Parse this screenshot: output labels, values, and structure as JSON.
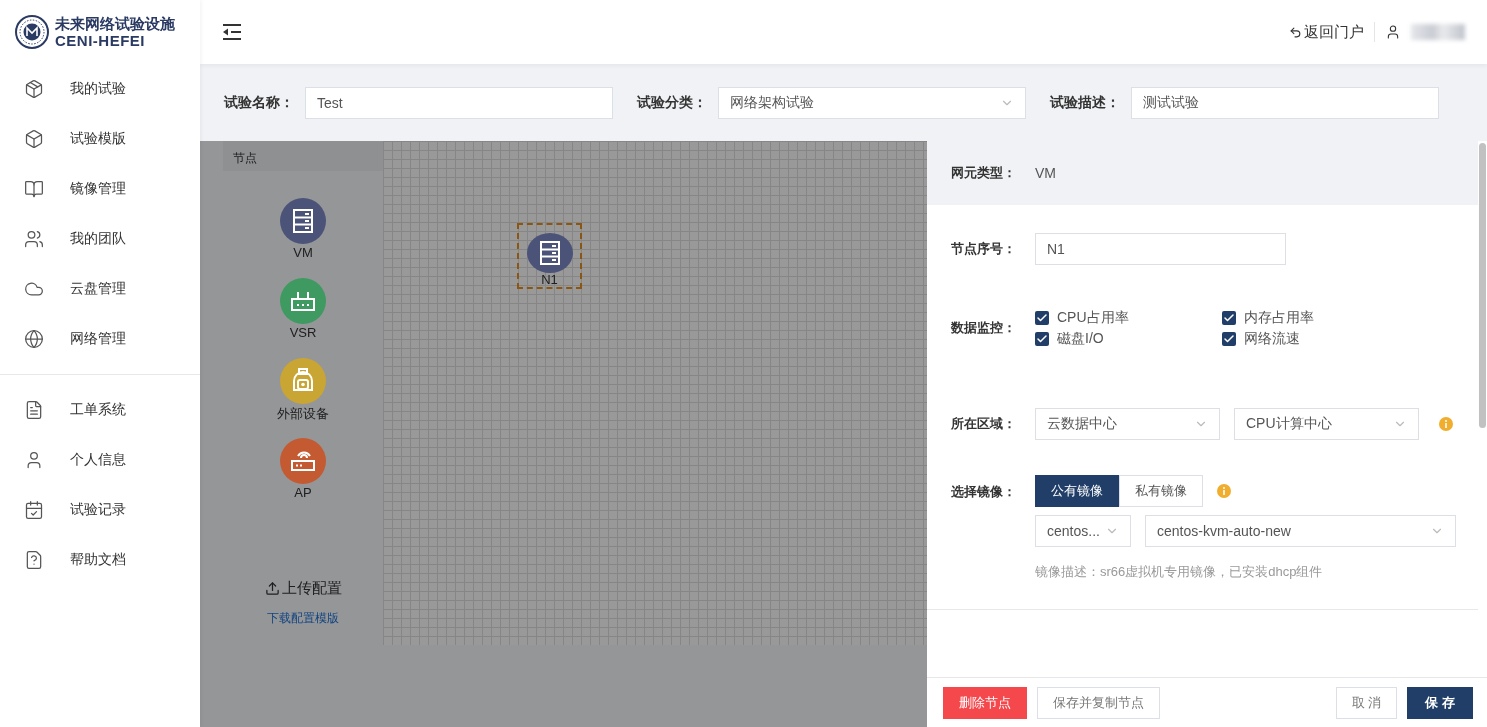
{
  "logo": {
    "title": "未来网络试验设施",
    "subtitle": "CENI-HEFEI"
  },
  "sidebar": {
    "groups": [
      {
        "items": [
          {
            "label": "我的试验",
            "selected": false
          },
          {
            "label": "试验模版",
            "selected": false
          },
          {
            "label": "镜像管理",
            "selected": false
          },
          {
            "label": "我的团队",
            "selected": false
          },
          {
            "label": "云盘管理",
            "selected": false
          },
          {
            "label": "网络管理",
            "selected": false
          }
        ]
      },
      {
        "items": [
          {
            "label": "工单系统",
            "selected": false
          },
          {
            "label": "个人信息",
            "selected": false
          },
          {
            "label": "试验记录",
            "selected": false
          },
          {
            "label": "帮助文档",
            "selected": false
          }
        ]
      }
    ]
  },
  "header": {
    "back_link": "返回门户"
  },
  "experiment_form": {
    "fields": [
      {
        "kind": "input",
        "label": "试验名称：",
        "value": "Test"
      },
      {
        "kind": "select",
        "label": "试验分类：",
        "value": "网络架构试验"
      },
      {
        "kind": "textarea",
        "label": "试验描述：",
        "value": "测试试验"
      }
    ]
  },
  "node_palette": {
    "title": "节点",
    "items": [
      {
        "kind": "server",
        "label": "VM",
        "color": "#4b5478"
      },
      {
        "kind": "router",
        "label": "VSR",
        "color": "#3e9a60"
      },
      {
        "kind": "camera",
        "label": "外部设备",
        "color": "#c9a533"
      },
      {
        "kind": "ap",
        "label": "AP",
        "color": "#c45a32"
      }
    ],
    "upload": "上传配置",
    "download_link": "下载配置模版"
  },
  "canvas": {
    "nodes": [
      {
        "kind": "server",
        "label": "N1",
        "selected": true
      }
    ]
  },
  "drawer": {
    "type_label": "网元类型：",
    "type_value": "VM",
    "node_id": {
      "label": "节点序号：",
      "value": "N1"
    },
    "monitoring": {
      "label": "数据监控：",
      "options": [
        {
          "label": "CPU占用率",
          "checked": true
        },
        {
          "label": "内存占用率",
          "checked": true
        },
        {
          "label": "磁盘I/O",
          "checked": true
        },
        {
          "label": "网络流速",
          "checked": true
        }
      ]
    },
    "region": {
      "label": "所在区域：",
      "selects": [
        "云数据中心",
        "CPU计算中心"
      ]
    },
    "image": {
      "label": "选择镜像：",
      "tabs": [
        {
          "label": "公有镜像",
          "selected": true
        },
        {
          "label": "私有镜像",
          "selected": false
        }
      ],
      "selects": [
        "centos...",
        "centos-kvm-auto-new"
      ],
      "description": "镜像描述：sr66虚拟机专用镜像，已安装dhcp组件"
    },
    "buttons": [
      {
        "kind": "danger",
        "label": "删除节点"
      },
      {
        "kind": "default",
        "label": "保存并复制节点"
      },
      {
        "kind": "default",
        "label": "取 消"
      },
      {
        "kind": "primary",
        "label": "保 存"
      }
    ]
  }
}
